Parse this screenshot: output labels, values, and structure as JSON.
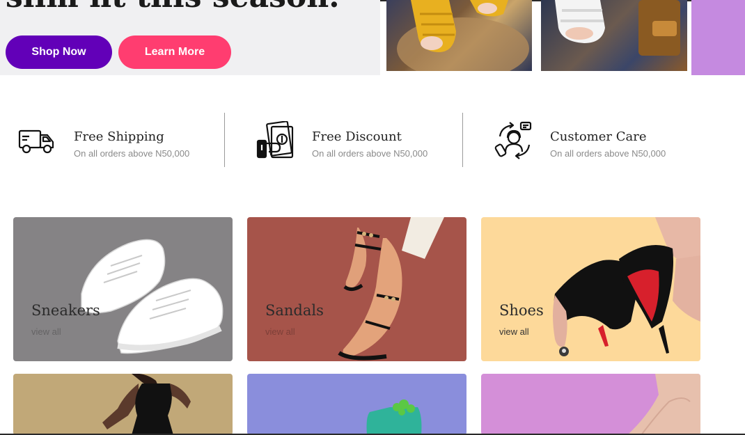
{
  "hero": {
    "heading": "slim fit this season.",
    "shop_label": "Shop Now",
    "learn_label": "Learn More",
    "colors": {
      "shop": "#6200b8",
      "learn": "#ff3d70",
      "background": "#f0f0f2"
    }
  },
  "features": [
    {
      "icon": "delivery-truck-icon",
      "title": "Free Shipping",
      "subtitle": "On all orders above N50,000"
    },
    {
      "icon": "cash-discount-icon",
      "title": "Free Discount",
      "subtitle": "On all orders above N50,000"
    },
    {
      "icon": "customer-care-icon",
      "title": "Customer Care",
      "subtitle": "On all orders above N50,000"
    }
  ],
  "categories": [
    {
      "title": "Sneakers",
      "link": "view all",
      "color": "#858385"
    },
    {
      "title": "Sandals",
      "link": "view all",
      "color": "#a6544a"
    },
    {
      "title": "Shoes",
      "link": "view all",
      "color": "#fdd99a"
    },
    {
      "title": "",
      "link": "",
      "color": "#c1a878"
    },
    {
      "title": "",
      "link": "",
      "color": "#8a8edc"
    },
    {
      "title": "",
      "link": "",
      "color": "#d48fd8"
    }
  ]
}
